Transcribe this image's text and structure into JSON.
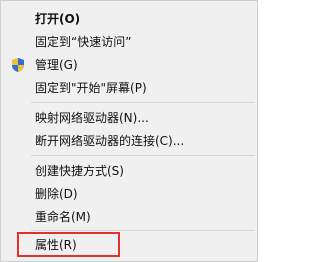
{
  "menu": {
    "open_label": "打开(O)",
    "pin_quick_access_label": "固定到“快速访问”",
    "manage_label": "管理(G)",
    "pin_start_label": "固定到\"开始\"屏幕(P)",
    "map_drive_label": "映射网络驱动器(N)...",
    "disconnect_drive_label": "断开网络驱动器的连接(C)...",
    "create_shortcut_label": "创建快捷方式(S)",
    "delete_label": "删除(D)",
    "rename_label": "重命名(M)",
    "properties_label": "属性(R)"
  },
  "icons": {
    "manage_icon": "uac-shield-icon"
  },
  "colors": {
    "menu_background": "#f0f0f0",
    "highlight_border": "#e0312f",
    "separator": "#d6d6d6"
  }
}
